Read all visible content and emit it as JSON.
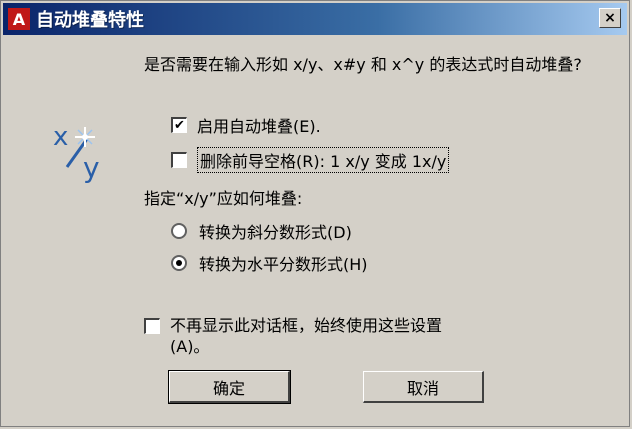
{
  "window": {
    "title": "自动堆叠特性",
    "app_icon_glyph": "A",
    "close_glyph": "×"
  },
  "question": "是否需要在输入形如 x/y、x#y 和 x^y 的表达式时自动堆叠?",
  "icon": {
    "name": "stack-fraction-icon",
    "top": "x",
    "bottom": "y"
  },
  "options": {
    "enable_autostack": {
      "label": "启用自动堆叠(E).",
      "checked": true
    },
    "remove_spaces": {
      "label": "删除前导空格(R): 1 x/y 变成 1x/y",
      "checked": false
    }
  },
  "stack_section": {
    "label": "指定“x/y”应如何堆叠:",
    "choices": [
      {
        "label": "转换为斜分数形式(D)",
        "selected": false
      },
      {
        "label": "转换为水平分数形式(H)",
        "selected": true
      }
    ]
  },
  "dont_show": {
    "line1": "不再显示此对话框，始终使用这些设置",
    "line2": "(A)。",
    "checked": false
  },
  "buttons": {
    "ok": "确定",
    "cancel": "取消"
  }
}
